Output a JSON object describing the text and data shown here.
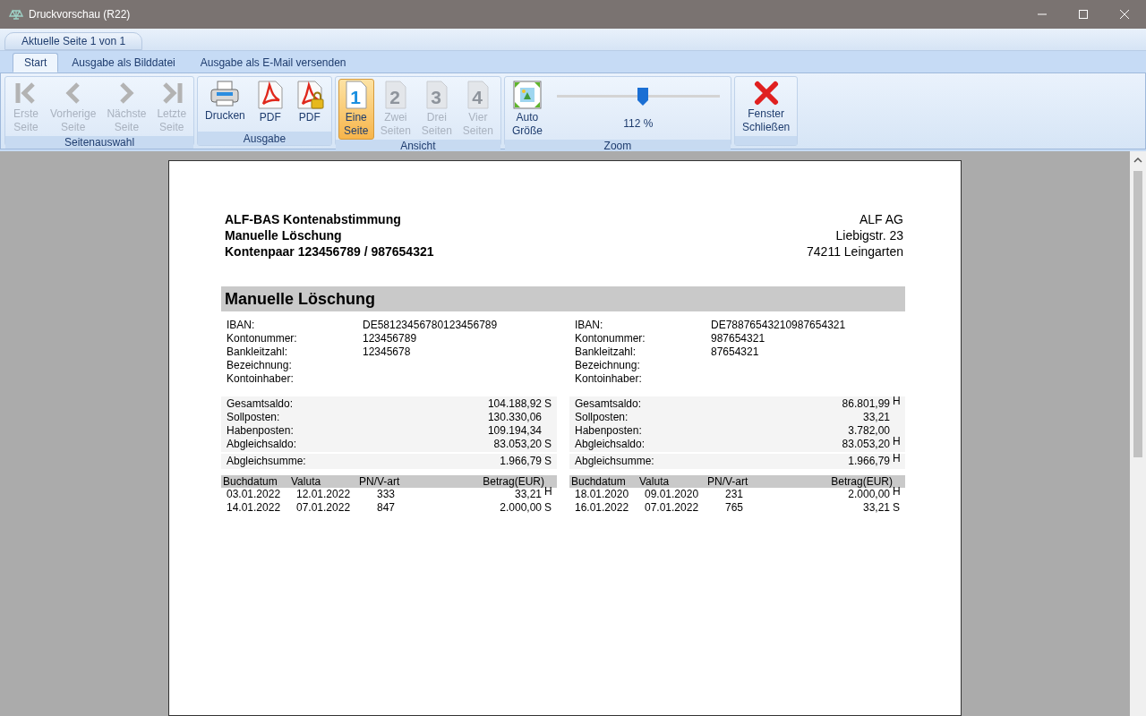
{
  "window": {
    "title": "Druckvorschau (R22)"
  },
  "page_tab": {
    "label": "Aktuelle Seite 1 von 1",
    "selected": true
  },
  "ribbon": {
    "tabs": [
      {
        "label": "Start",
        "selected": true
      },
      {
        "label": "Ausgabe als Bilddatei",
        "selected": false
      },
      {
        "label": "Ausgabe als E-Mail versenden",
        "selected": false
      }
    ],
    "groups": [
      {
        "label": "Seitenauswahl",
        "items": [
          {
            "kind": "first",
            "lines": [
              "Erste",
              "Seite"
            ],
            "disabled": true,
            "selected": false
          },
          {
            "kind": "prev",
            "lines": [
              "Vorherige",
              "Seite"
            ],
            "disabled": true,
            "selected": false
          },
          {
            "kind": "next",
            "lines": [
              "Nächste",
              "Seite"
            ],
            "disabled": true,
            "selected": false
          },
          {
            "kind": "last",
            "lines": [
              "Letzte",
              "Seite"
            ],
            "disabled": true,
            "selected": false
          }
        ]
      },
      {
        "label": "Ausgabe",
        "items": [
          {
            "kind": "print",
            "lines": [
              "Drucken"
            ],
            "disabled": false,
            "selected": false
          },
          {
            "kind": "pdf",
            "lines": [
              "PDF"
            ],
            "disabled": false,
            "selected": false
          },
          {
            "kind": "pdf-lock",
            "lines": [
              "PDF"
            ],
            "disabled": false,
            "selected": false
          }
        ]
      },
      {
        "label": "Ansicht",
        "items": [
          {
            "kind": "page",
            "icon_text": "1",
            "lines": [
              "Eine",
              "Seite"
            ],
            "disabled": false,
            "selected": true
          },
          {
            "kind": "page",
            "icon_text": "2",
            "lines": [
              "Zwei",
              "Seiten"
            ],
            "disabled": true,
            "selected": false
          },
          {
            "kind": "page",
            "icon_text": "3",
            "lines": [
              "Drei",
              "Seiten"
            ],
            "disabled": true,
            "selected": false
          },
          {
            "kind": "page",
            "icon_text": "4",
            "lines": [
              "Vier",
              "Seiten"
            ],
            "disabled": true,
            "selected": false
          }
        ]
      },
      {
        "label": "Zoom",
        "items": [
          {
            "kind": "autosize",
            "lines": [
              "Auto",
              "Größe"
            ],
            "disabled": false,
            "selected": false
          },
          {
            "kind": "slider",
            "level": 0.53,
            "reading": "112 %"
          }
        ]
      },
      {
        "items": [
          {
            "kind": "close",
            "lines": [
              "Fenster",
              "Schließen"
            ],
            "disabled": false,
            "selected": false
          }
        ]
      }
    ]
  },
  "report": {
    "header_left": [
      "ALF-BAS Kontenabstimmung",
      "Manuelle Löschung",
      "Kontenpaar 123456789 / 987654321"
    ],
    "header_right": [
      "ALF AG",
      "Liebigstr. 23",
      "74211 Leingarten"
    ],
    "section_title": "Manuelle Löschung",
    "accounts": [
      {
        "details": [
          {
            "label": "IBAN:",
            "value": "DE58123456780123456789"
          },
          {
            "label": "Kontonummer:",
            "value": "123456789"
          },
          {
            "label": "Bankleitzahl:",
            "value": "12345678"
          },
          {
            "label": "Bezeichnung:"
          },
          {
            "label": "Kontoinhaber:"
          }
        ],
        "balances": [
          {
            "label": "Gesamtsaldo:",
            "value": "104.188,92",
            "side": "S"
          },
          {
            "label": "Sollposten:",
            "value": "130.330,06"
          },
          {
            "label": "Habenposten:",
            "value": "109.194,34"
          },
          {
            "label": "Abgleichsaldo:",
            "value": "83.053,20",
            "side": "S"
          }
        ],
        "sum": {
          "label": "Abgleichsumme:",
          "value": "1.966,79",
          "side": "S"
        },
        "columns": [
          "Buchdatum",
          "Valuta",
          "PN/V-art",
          "Betrag(EUR)"
        ],
        "rows": [
          {
            "date": "03.01.2022",
            "valuta": "12.01.2022",
            "pn": "333",
            "amount": "33,21",
            "side": "H"
          },
          {
            "date": "14.01.2022",
            "valuta": "07.01.2022",
            "pn": "847",
            "amount": "2.000,00",
            "side": "S"
          }
        ]
      },
      {
        "details": [
          {
            "label": "IBAN:",
            "value": "DE78876543210987654321"
          },
          {
            "label": "Kontonummer:",
            "value": "987654321"
          },
          {
            "label": "Bankleitzahl:",
            "value": "87654321"
          },
          {
            "label": "Bezeichnung:"
          },
          {
            "label": "Kontoinhaber:"
          }
        ],
        "balances": [
          {
            "label": "Gesamtsaldo:",
            "value": "86.801,99",
            "side": "H"
          },
          {
            "label": "Sollposten:",
            "value": "33,21"
          },
          {
            "label": "Habenposten:",
            "value": "3.782,00"
          },
          {
            "label": "Abgleichsaldo:",
            "value": "83.053,20",
            "side": "H"
          }
        ],
        "sum": {
          "label": "Abgleichsumme:",
          "value": "1.966,79",
          "side": "H"
        },
        "columns": [
          "Buchdatum",
          "Valuta",
          "PN/V-art",
          "Betrag(EUR)"
        ],
        "rows": [
          {
            "date": "18.01.2020",
            "valuta": "09.01.2020",
            "pn": "231",
            "amount": "2.000,00",
            "side": "H"
          },
          {
            "date": "16.01.2022",
            "valuta": "07.01.2022",
            "pn": "765",
            "amount": "33,21",
            "side": "S"
          }
        ]
      }
    ]
  }
}
